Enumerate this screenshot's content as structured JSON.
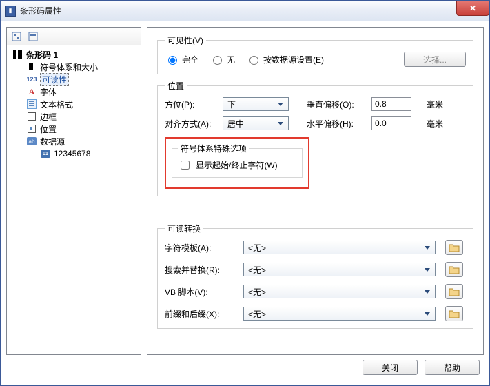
{
  "window": {
    "title": "条形码属性"
  },
  "tree": {
    "root": "条形码 1",
    "items": [
      {
        "label": "符号体系和大小"
      },
      {
        "label": "可读性",
        "selected": true
      },
      {
        "label": "字体"
      },
      {
        "label": "文本格式"
      },
      {
        "label": "边框"
      },
      {
        "label": "位置"
      },
      {
        "label": "数据源",
        "children": [
          {
            "label": "12345678"
          }
        ]
      }
    ]
  },
  "visibility": {
    "legend": "可见性(V)",
    "option_full": "完全",
    "option_none": "无",
    "option_datasource": "按数据源设置(E)",
    "selected": "full",
    "select_button": "选择..."
  },
  "position": {
    "legend": "位置",
    "orientation_label": "方位(P):",
    "orientation_value": "下",
    "align_label": "对齐方式(A):",
    "align_value": "居中",
    "voffset_label": "垂直偏移(O):",
    "voffset_value": "0.8",
    "hoffset_label": "水平偏移(H):",
    "hoffset_value": "0.0",
    "unit": "毫米"
  },
  "symbol_opts": {
    "legend": "符号体系特殊选项",
    "show_startstop": "显示起始/终止字符(W)",
    "checked": false
  },
  "transform": {
    "legend": "可读转换",
    "template_label": "字符模板(A):",
    "template_value": "<无>",
    "search_label": "搜索并替换(R):",
    "search_value": "<无>",
    "vb_label": "VB 脚本(V):",
    "vb_value": "<无>",
    "affix_label": "前缀和后缀(X):",
    "affix_value": "<无>"
  },
  "buttons": {
    "close": "关闭",
    "help": "帮助"
  }
}
